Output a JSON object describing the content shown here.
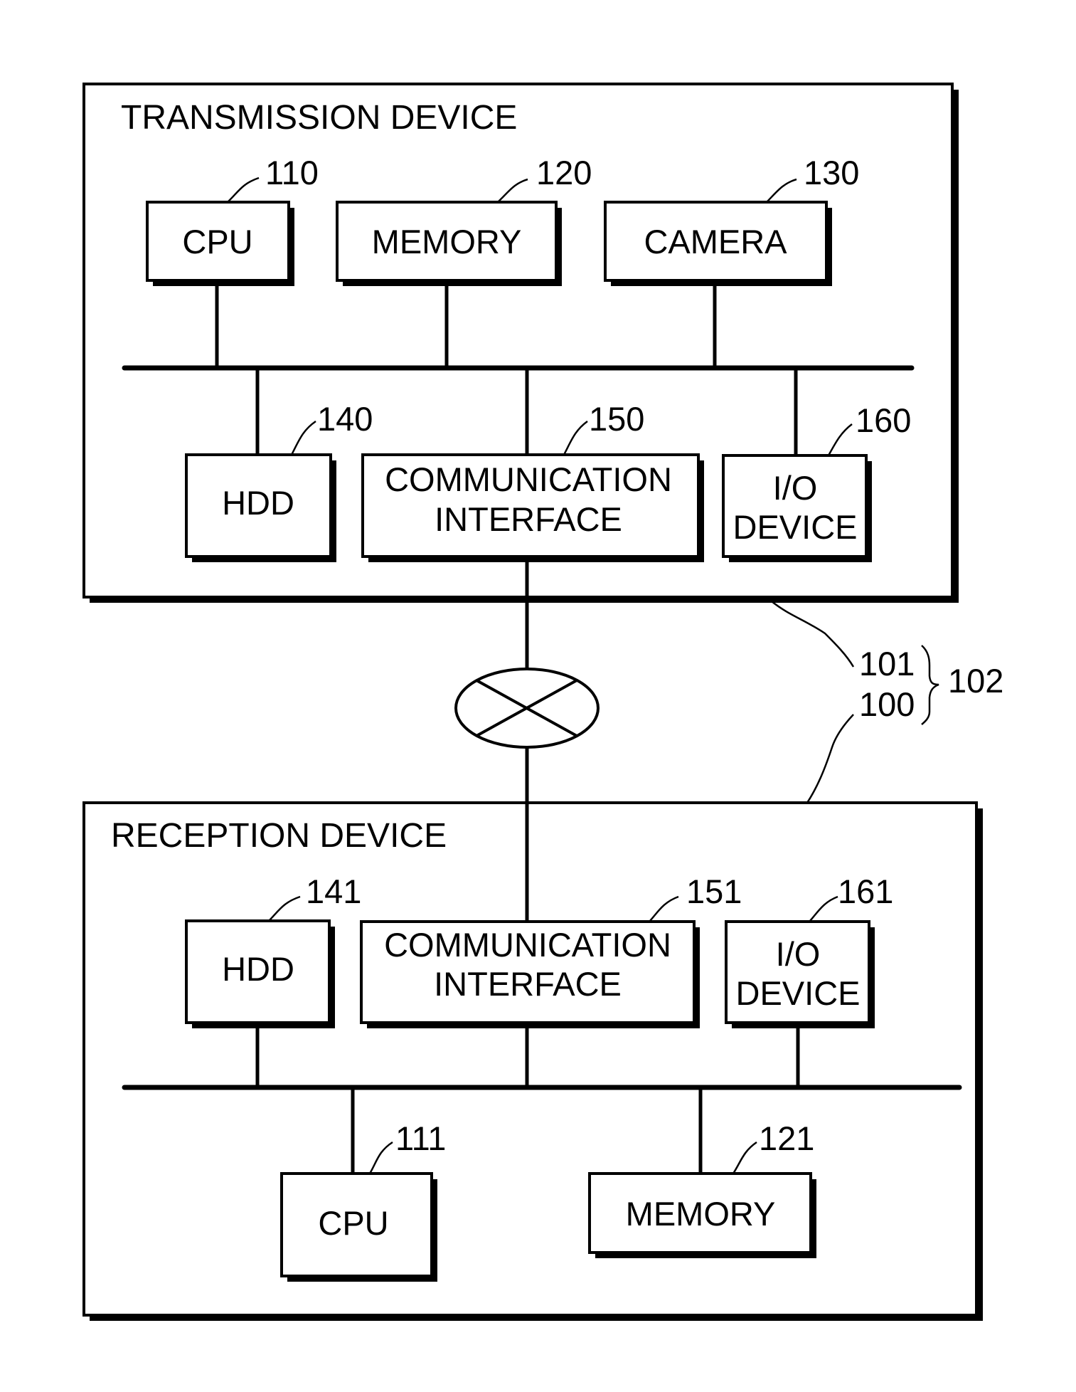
{
  "diagram": {
    "type": "block-diagram",
    "transmission_device": {
      "title": "TRANSMISSION DEVICE",
      "components": {
        "cpu": {
          "label": "CPU",
          "ref": "110"
        },
        "memory": {
          "label": "MEMORY",
          "ref": "120"
        },
        "camera": {
          "label": "CAMERA",
          "ref": "130"
        },
        "hdd": {
          "label": "HDD",
          "ref": "140"
        },
        "comm": {
          "label_line1": "COMMUNICATION",
          "label_line2": "INTERFACE",
          "ref": "150"
        },
        "io": {
          "label_line1": "I/O",
          "label_line2": "DEVICE",
          "ref": "160"
        }
      }
    },
    "reception_device": {
      "title": "RECEPTION DEVICE",
      "components": {
        "hdd": {
          "label": "HDD",
          "ref": "141"
        },
        "comm": {
          "label_line1": "COMMUNICATION",
          "label_line2": "INTERFACE",
          "ref": "151"
        },
        "io": {
          "label_line1": "I/O",
          "label_line2": "DEVICE",
          "ref": "161"
        },
        "cpu": {
          "label": "CPU",
          "ref": "111"
        },
        "memory": {
          "label": "MEMORY",
          "ref": "121"
        }
      }
    },
    "network": {
      "symbol": "network-crossed-ellipse-icon"
    },
    "system_refs": {
      "transmission": "101",
      "reception": "100",
      "system": "102"
    }
  }
}
